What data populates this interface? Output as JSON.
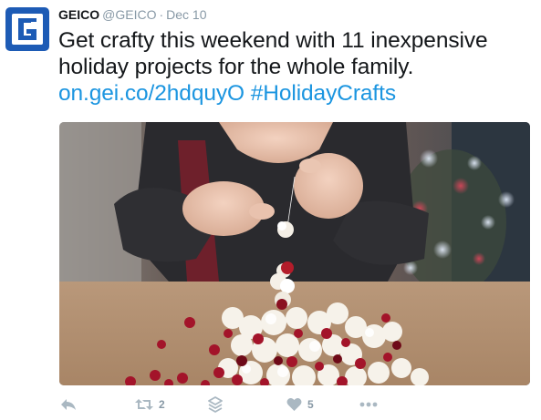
{
  "tweet": {
    "author_name": "GEICO",
    "author_handle": "@GEICO",
    "separator": "·",
    "date": "Dec 10",
    "text_line1": "Get crafty this weekend with 11 inexpensive",
    "text_line2": "holiday projects for the whole family.",
    "link_text": "on.gei.co/2hdquyO",
    "hashtag": "#HolidayCrafts"
  },
  "actions": {
    "reply_icon": "reply-arrow",
    "retweet_icon": "retweet-arrows",
    "retweet_count": "2",
    "stack_icon": "layers-stack",
    "like_icon": "heart",
    "like_count": "5",
    "more_icon": "ellipsis"
  },
  "colors": {
    "brand_blue": "#1d5bb5",
    "link_blue": "#1b95e0",
    "icon_gray": "#aab8c2",
    "count_gray": "#8899a6",
    "text": "#14171a"
  }
}
